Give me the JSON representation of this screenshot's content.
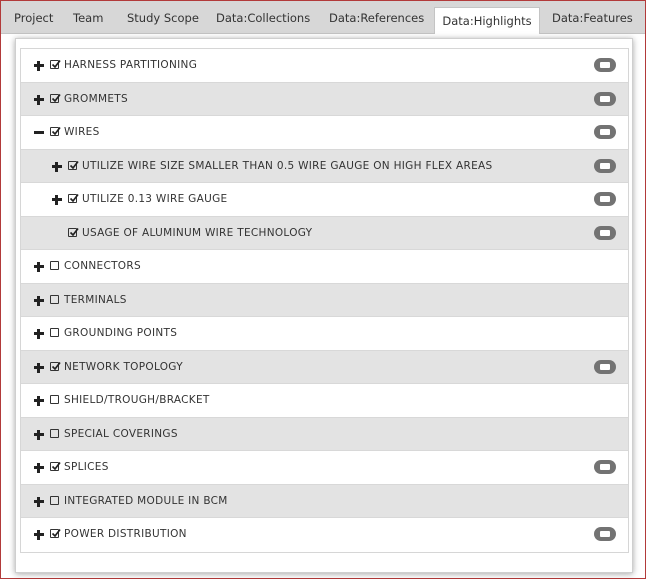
{
  "tabs": [
    {
      "label": "Project"
    },
    {
      "label": "Team"
    },
    {
      "label": "Study Scope"
    },
    {
      "label": "Data:Collections"
    },
    {
      "label": "Data:References"
    },
    {
      "label": "Data:Highlights",
      "active": true
    },
    {
      "label": "Data:Features"
    }
  ],
  "items": [
    {
      "label": "HARNESS PARTITIONING",
      "level": 0,
      "toggle": "plus",
      "checked": true,
      "comment": true
    },
    {
      "label": "GROMMETS",
      "level": 0,
      "toggle": "plus",
      "checked": true,
      "comment": true
    },
    {
      "label": "WIRES",
      "level": 0,
      "toggle": "minus",
      "checked": true,
      "comment": true
    },
    {
      "label": "UTILIZE WIRE SIZE SMALLER THAN 0.5 WIRE GAUGE ON HIGH FLEX AREAS",
      "level": 1,
      "toggle": "plus",
      "checked": true,
      "comment": true
    },
    {
      "label": "UTILIZE 0.13 WIRE GAUGE",
      "level": 1,
      "toggle": "plus",
      "checked": true,
      "comment": true
    },
    {
      "label": "USAGE OF ALUMINUM WIRE TECHNOLOGY",
      "level": 1,
      "toggle": "none",
      "checked": true,
      "comment": true
    },
    {
      "label": "CONNECTORS",
      "level": 0,
      "toggle": "plus",
      "checked": false,
      "comment": false
    },
    {
      "label": "TERMINALS",
      "level": 0,
      "toggle": "plus",
      "checked": false,
      "comment": false
    },
    {
      "label": "GROUNDING POINTS",
      "level": 0,
      "toggle": "plus",
      "checked": false,
      "comment": false
    },
    {
      "label": "NETWORK TOPOLOGY",
      "level": 0,
      "toggle": "plus",
      "checked": true,
      "comment": true
    },
    {
      "label": "SHIELD/TROUGH/BRACKET",
      "level": 0,
      "toggle": "plus",
      "checked": false,
      "comment": false
    },
    {
      "label": "SPECIAL COVERINGS",
      "level": 0,
      "toggle": "plus",
      "checked": false,
      "comment": false
    },
    {
      "label": "SPLICES",
      "level": 0,
      "toggle": "plus",
      "checked": true,
      "comment": true
    },
    {
      "label": "INTEGRATED MODULE IN BCM",
      "level": 0,
      "toggle": "plus",
      "checked": false,
      "comment": false
    },
    {
      "label": "POWER DISTRIBUTION",
      "level": 0,
      "toggle": "plus",
      "checked": true,
      "comment": true
    }
  ],
  "icons": {
    "expand": "plus-icon",
    "collapse": "minus-icon",
    "checked": "checked-box-icon",
    "unchecked": "empty-box-icon",
    "comment": "comment-bubble-icon"
  },
  "colors": {
    "frame_border": "#b23a3a",
    "row_alt": "#e3e3e3",
    "tab_bar": "#d7d7d7",
    "comment_badge": "#737373"
  }
}
